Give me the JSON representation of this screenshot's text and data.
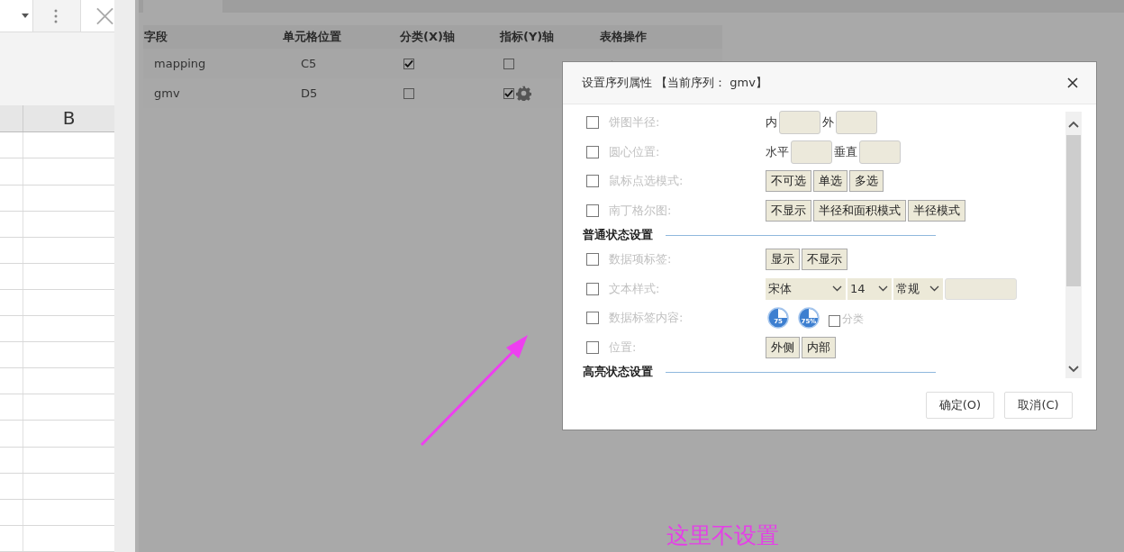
{
  "spreadsheet": {
    "column_header": "B"
  },
  "table": {
    "columns": [
      "字段",
      "单元格位置",
      "分类(X)轴",
      "指标(Y)轴",
      "表格操作"
    ],
    "rows": [
      {
        "field": "mapping",
        "cell": "C5",
        "x_axis": true,
        "y_axis": false
      },
      {
        "field": "gmv",
        "cell": "D5",
        "x_axis": false,
        "y_axis": true
      }
    ]
  },
  "dialog": {
    "title": "设置序列属性 【当前序列： gmv】",
    "items": [
      {
        "kind": "inputs",
        "label": "饼图半径:",
        "checked": false,
        "fields": [
          {
            "prefix": "内"
          },
          {
            "prefix": "外"
          }
        ]
      },
      {
        "kind": "inputs",
        "label": "圆心位置:",
        "checked": false,
        "fields": [
          {
            "prefix": "水平"
          },
          {
            "prefix": "垂直"
          }
        ]
      },
      {
        "kind": "buttons",
        "label": "鼠标点选模式:",
        "checked": false,
        "options": [
          "不可选",
          "单选",
          "多选"
        ]
      },
      {
        "kind": "buttons",
        "label": "南丁格尔图:",
        "checked": false,
        "options": [
          "不显示",
          "半径和面积模式",
          "半径模式"
        ]
      },
      {
        "kind": "heading",
        "label": "普通状态设置"
      },
      {
        "kind": "buttons",
        "label": "数据项标签:",
        "checked": false,
        "options": [
          "显示",
          "不显示"
        ]
      },
      {
        "kind": "font",
        "label": "文本样式:",
        "checked": false,
        "selects": [
          "宋体",
          "14",
          "常规"
        ]
      },
      {
        "kind": "label_content",
        "label": "数据标签内容:",
        "checked": false,
        "badges": [
          "75",
          "75%"
        ],
        "option": {
          "label": "分类",
          "checked": false
        }
      },
      {
        "kind": "buttons",
        "label": "位置:",
        "checked": false,
        "options": [
          "外侧",
          "内部"
        ]
      },
      {
        "kind": "heading",
        "label": "高亮状态设置"
      }
    ],
    "buttons": [
      "确定(O)",
      "取消(C)"
    ]
  },
  "annotation": {
    "text": "这里不设置"
  }
}
